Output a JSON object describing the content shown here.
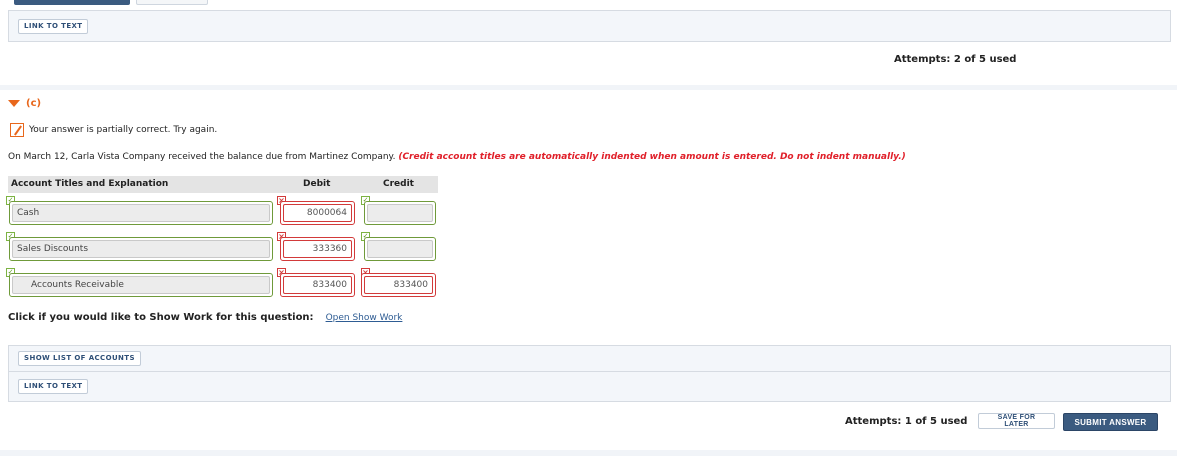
{
  "top_section": {
    "link_to_text_label": "LINK TO TEXT",
    "attempts": "Attempts: 2 of 5 used"
  },
  "part": {
    "label": "(c)",
    "feedback": "Your answer is partially correct.  Try again.",
    "question_text": "On March 12, Carla Vista Company received the balance due from Martinez Company.",
    "question_hint": "(Credit account titles are automatically indented when amount is entered. Do not indent manually.)"
  },
  "journal": {
    "headers": {
      "account": "Account Titles and Explanation",
      "debit": "Debit",
      "credit": "Credit"
    },
    "rows": [
      {
        "account": "Cash",
        "debit": "8000064",
        "credit": "",
        "account_status": "correct",
        "debit_status": "incorrect",
        "credit_status": "correct"
      },
      {
        "account": "Sales Discounts",
        "debit": "333360",
        "credit": "",
        "account_status": "correct",
        "debit_status": "incorrect",
        "credit_status": "correct"
      },
      {
        "account": "Accounts Receivable",
        "debit": "833400",
        "credit": "833400",
        "account_status": "correct",
        "debit_status": "incorrect",
        "credit_status": "incorrect"
      }
    ]
  },
  "show_work": {
    "label": "Click if you would like to Show Work for this question:",
    "link": "Open Show Work"
  },
  "bottom_panel": {
    "show_list_label": "SHOW LIST OF ACCOUNTS",
    "link_to_text_label": "LINK TO TEXT"
  },
  "footer": {
    "attempts": "Attempts: 1 of 5 used",
    "save_label": "SAVE FOR LATER",
    "submit_label": "SUBMIT ANSWER"
  },
  "colors": {
    "accent_orange": "#e8671c",
    "error_red": "#d23a3a",
    "correct_green": "#6f9a3a",
    "primary_blue": "#3b5b80"
  }
}
